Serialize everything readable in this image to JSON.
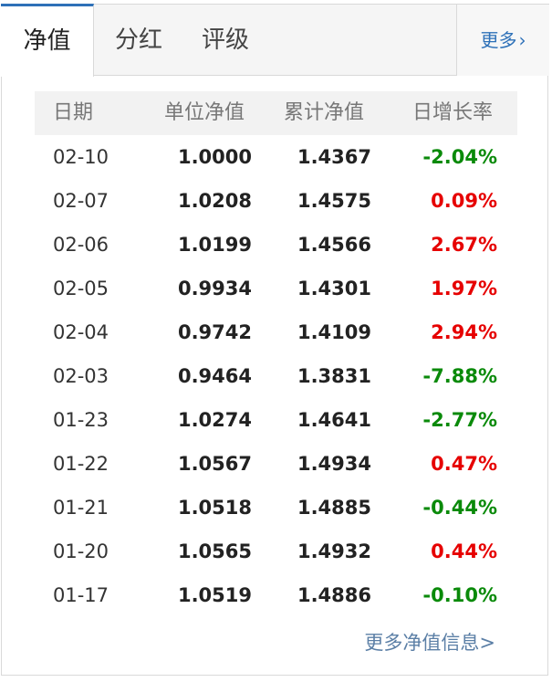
{
  "tabs": {
    "nav": [
      "净值",
      "分红",
      "评级"
    ],
    "more": "更多",
    "more_chevron": "›"
  },
  "table": {
    "headers": [
      "日期",
      "单位净值",
      "累计净值",
      "日增长率"
    ],
    "rows": [
      {
        "date": "02-10",
        "unit": "1.0000",
        "acc": "1.4367",
        "change": "-2.04%",
        "dir": "down"
      },
      {
        "date": "02-07",
        "unit": "1.0208",
        "acc": "1.4575",
        "change": "0.09%",
        "dir": "up"
      },
      {
        "date": "02-06",
        "unit": "1.0199",
        "acc": "1.4566",
        "change": "2.67%",
        "dir": "up"
      },
      {
        "date": "02-05",
        "unit": "0.9934",
        "acc": "1.4301",
        "change": "1.97%",
        "dir": "up"
      },
      {
        "date": "02-04",
        "unit": "0.9742",
        "acc": "1.4109",
        "change": "2.94%",
        "dir": "up"
      },
      {
        "date": "02-03",
        "unit": "0.9464",
        "acc": "1.3831",
        "change": "-7.88%",
        "dir": "down"
      },
      {
        "date": "01-23",
        "unit": "1.0274",
        "acc": "1.4641",
        "change": "-2.77%",
        "dir": "down"
      },
      {
        "date": "01-22",
        "unit": "1.0567",
        "acc": "1.4934",
        "change": "0.47%",
        "dir": "up"
      },
      {
        "date": "01-21",
        "unit": "1.0518",
        "acc": "1.4885",
        "change": "-0.44%",
        "dir": "down"
      },
      {
        "date": "01-20",
        "unit": "1.0565",
        "acc": "1.4932",
        "change": "0.44%",
        "dir": "up"
      },
      {
        "date": "01-17",
        "unit": "1.0519",
        "acc": "1.4886",
        "change": "-0.10%",
        "dir": "down"
      }
    ]
  },
  "footer": {
    "more_info": "更多净值信息>"
  },
  "colors": {
    "up": "#e60000",
    "down": "#0a8a0a",
    "accent": "#2e71b8"
  }
}
